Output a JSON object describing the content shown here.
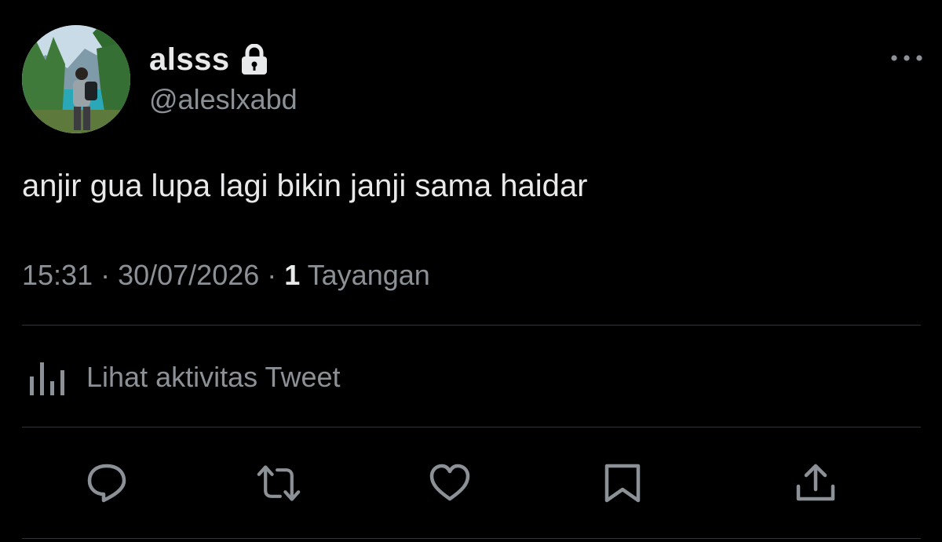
{
  "author": {
    "display_name": "alsss",
    "handle": "@aleslxabd",
    "protected_icon": "lock-icon",
    "avatar": "profile-photo"
  },
  "tweet": {
    "text": "anjir gua lupa lagi bikin janji sama haidar",
    "time": "15:31",
    "separator_1": " · ",
    "date": "30/07/2026",
    "separator_2": " · ",
    "views_count": "1",
    "views_label": " Tayangan"
  },
  "activity": {
    "icon": "analytics-bar-icon",
    "label": "Lihat aktivitas Tweet"
  },
  "actions": [
    "reply-icon",
    "retweet-icon",
    "like-icon",
    "bookmark-icon",
    "share-icon"
  ],
  "menu_icon": "more-options-icon",
  "colors": {
    "background": "#000000",
    "primary_text": "#e7e9ea",
    "secondary_text": "#8b9196",
    "divider": "#2f3336"
  }
}
